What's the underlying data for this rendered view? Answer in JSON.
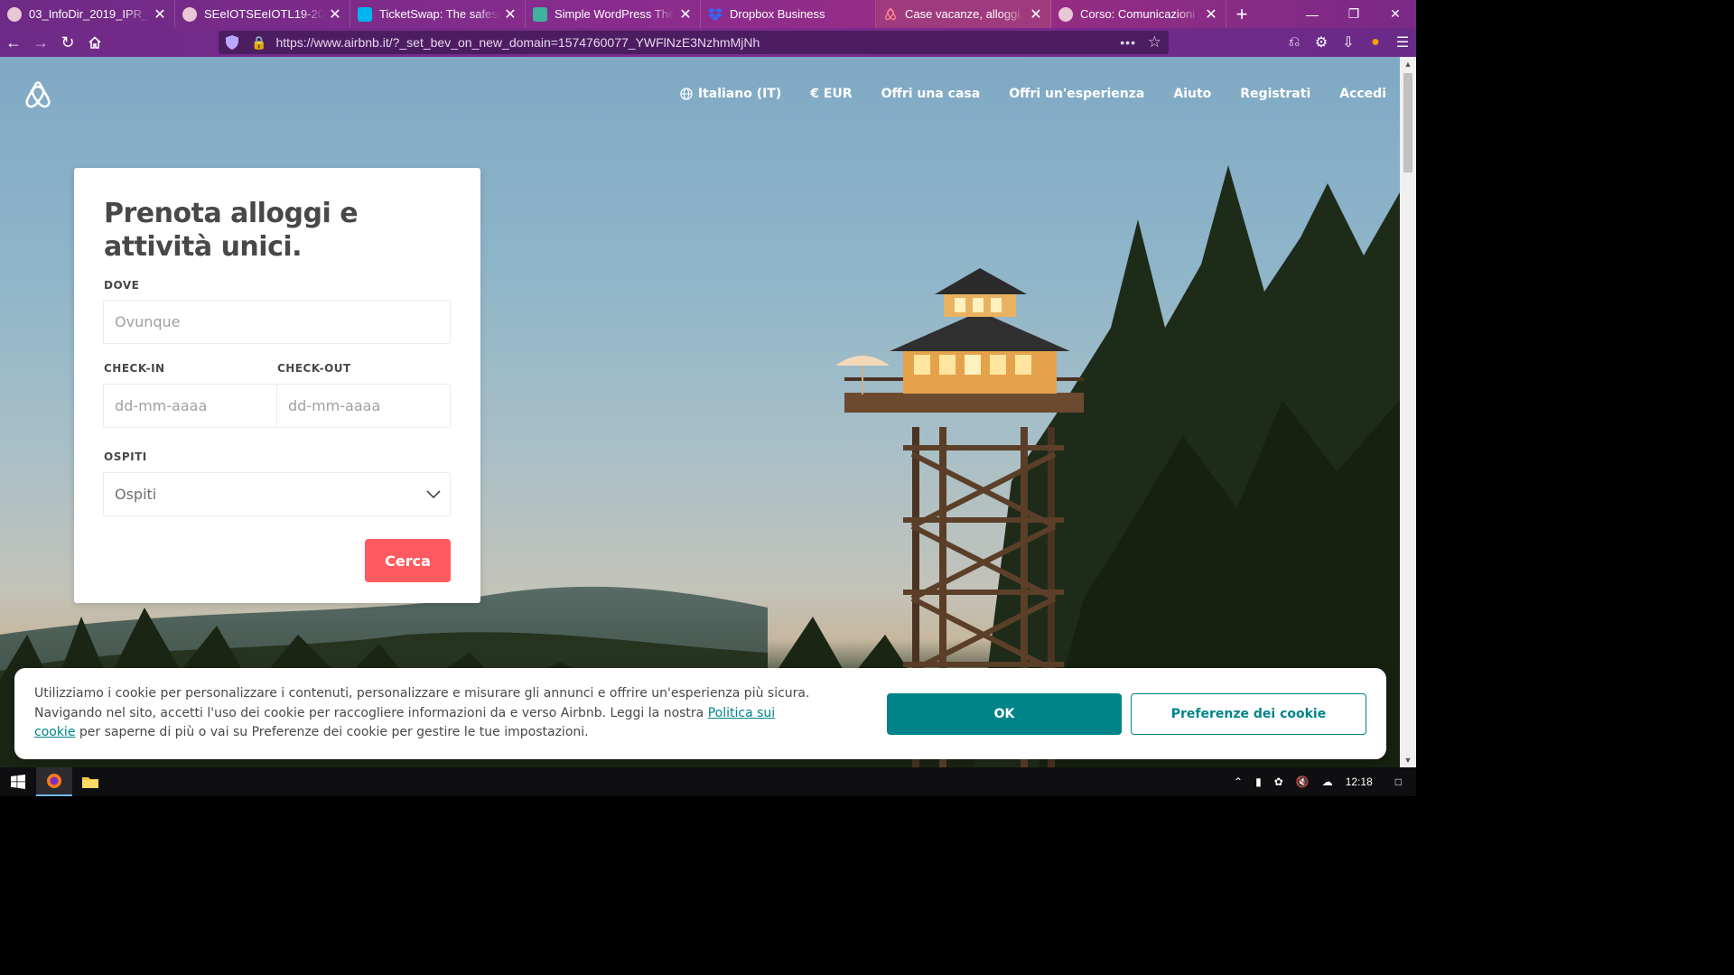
{
  "browser": {
    "tabs": [
      {
        "title": "03_InfoDir_2019_IPR_DE",
        "favicon": "dot-icon",
        "color": "#e8c8d4"
      },
      {
        "title": "SEeIOTSEeIOTL19-20/RIC",
        "favicon": "dot-icon",
        "color": "#e8c8d4"
      },
      {
        "title": "TicketSwap: The safest w",
        "favicon": "ticketswap-icon",
        "color": "#00b6f0"
      },
      {
        "title": "Simple WordPress Them",
        "favicon": "leaf-icon",
        "color": "#3fb39d"
      },
      {
        "title": "Dropbox Business",
        "favicon": "dropbox-icon",
        "color": "#0061fe"
      },
      {
        "title": "Case vacanze, alloggi, e",
        "favicon": "airbnb-icon",
        "color": "#ff5a5f"
      },
      {
        "title": "Corso: Comunicazioni D",
        "favicon": "dot-icon",
        "color": "#e8c8d4"
      }
    ],
    "active_tab": 5,
    "url": "https://www.airbnb.it/?_set_bev_on_new_domain=1574760077_YWFlNzE3NzhmMjNh"
  },
  "header": {
    "language": "Italiano (IT)",
    "currency": "€ EUR",
    "offer_home": "Offri una casa",
    "offer_experience": "Offri un'esperienza",
    "help": "Aiuto",
    "signup": "Registrati",
    "login": "Accedi"
  },
  "search": {
    "title": "Prenota alloggi e attività unici.",
    "where_label": "DOVE",
    "where_placeholder": "Ovunque",
    "checkin_label": "CHECK-IN",
    "checkin_placeholder": "dd-mm-aaaa",
    "checkout_label": "CHECK-OUT",
    "checkout_placeholder": "dd-mm-aaaa",
    "guests_label": "OSPITI",
    "guests_value": "Ospiti",
    "submit": "Cerca"
  },
  "cookie_banner": {
    "text_1": "Utilizziamo i cookie per personalizzare i contenuti, personalizzare e misurare gli annunci e offrire un'esperienza più sicura. Navigando nel sito, accetti l'uso dei cookie per raccogliere informazioni da e verso Airbnb. Leggi la nostra ",
    "link": "Politica sui cookie",
    "text_2": " per saperne di più o vai su Preferenze dei cookie per gestire le tue impostazioni.",
    "ok": "OK",
    "preferences": "Preferenze dei cookie"
  },
  "taskbar": {
    "time": "12:18"
  },
  "colors": {
    "brand": "#ff5a5f",
    "teal": "#008489"
  }
}
